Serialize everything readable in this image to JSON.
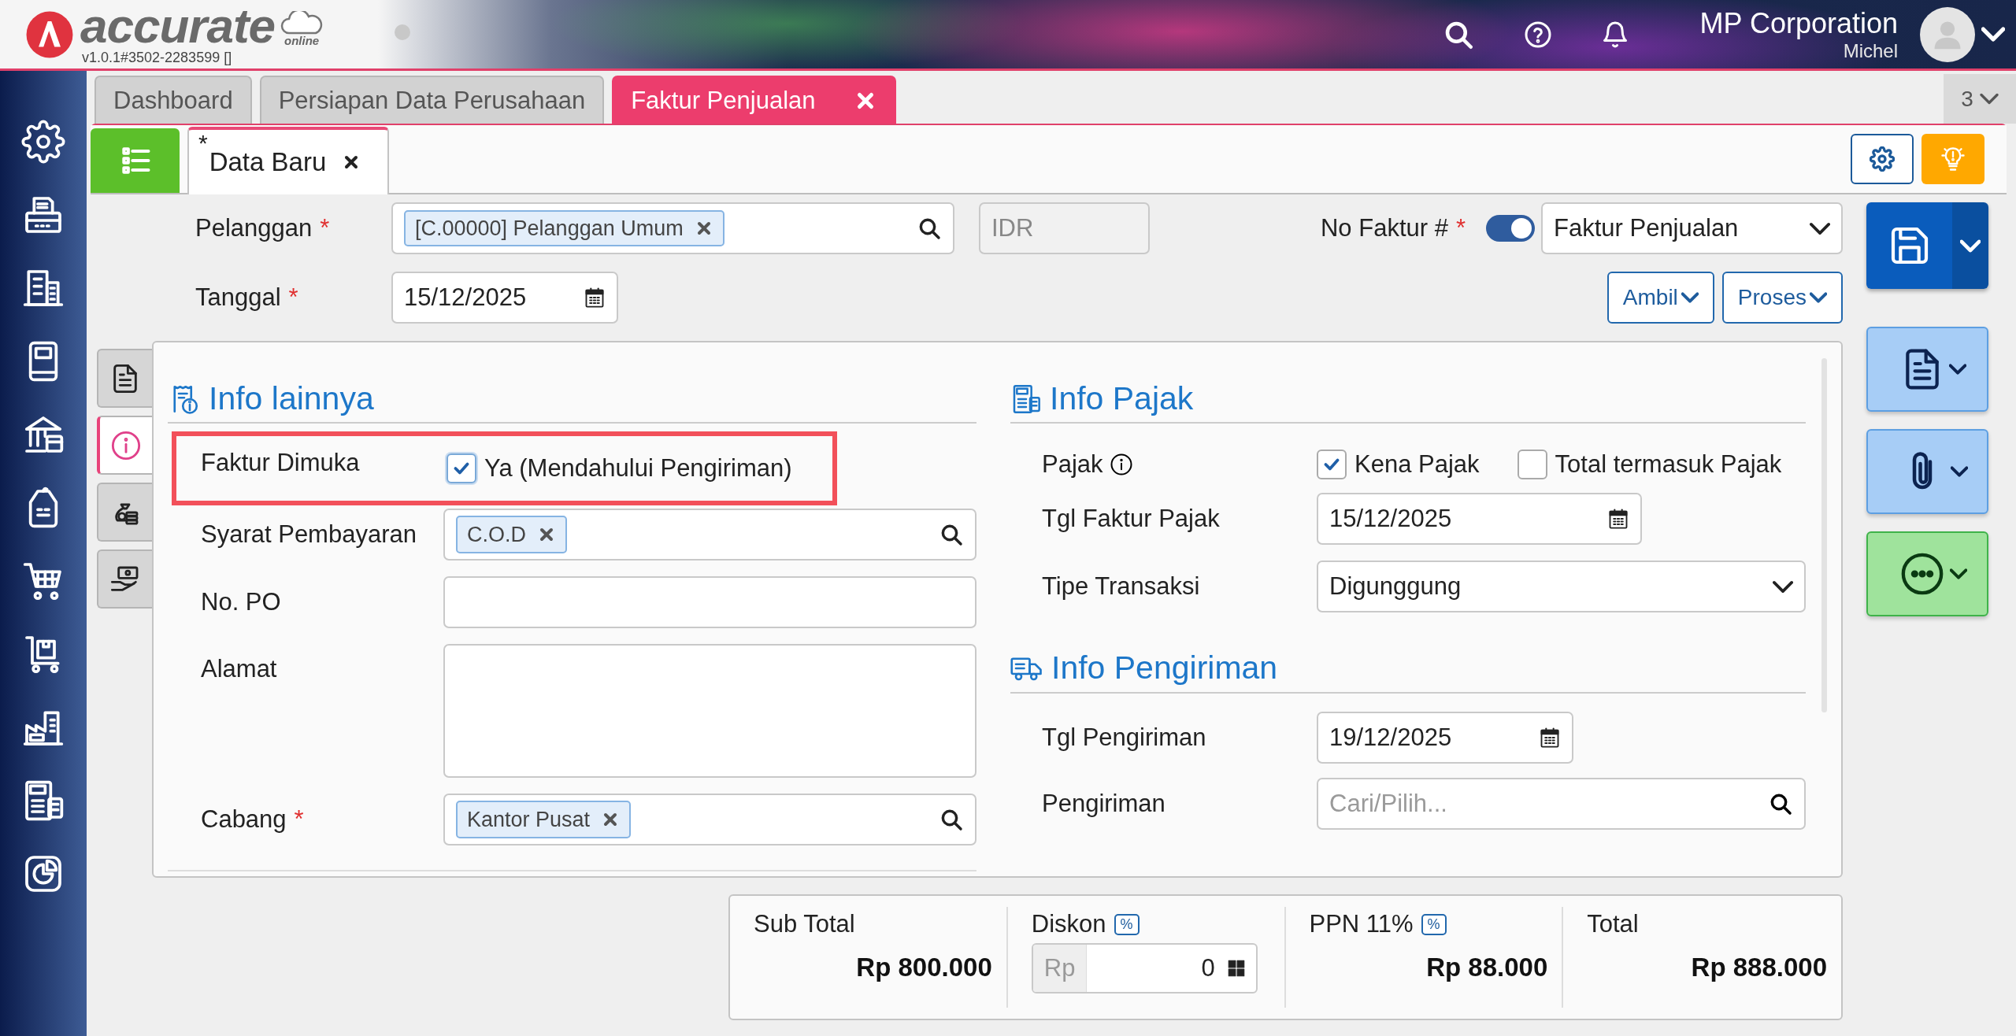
{
  "header": {
    "logo": "accurate",
    "logo_sub": "online",
    "version": "v1.0.1#3502-2283599 []",
    "company": "MP Corporation",
    "user": "Michel"
  },
  "tabs": [
    {
      "label": "Dashboard",
      "selected": false,
      "closable": false
    },
    {
      "label": "Persiapan Data Perusahaan",
      "selected": false,
      "closable": false
    },
    {
      "label": "Faktur Penjualan",
      "selected": true,
      "closable": true
    }
  ],
  "tab_count": "3",
  "subtab": {
    "label": "Data Baru",
    "modified_mark": "*",
    "selected": true,
    "closable": true
  },
  "form": {
    "customer": {
      "label": "Pelanggan",
      "mark": "*",
      "tag": "[C.00000] Pelanggan Umum"
    },
    "currency": {
      "value": "IDR",
      "disabled": true
    },
    "invoice_no": {
      "label": "No Faktur #",
      "mark": "*",
      "auto": true,
      "value": "Faktur Penjualan"
    },
    "date": {
      "label": "Tanggal",
      "mark": "*",
      "value": "15/12/2025"
    },
    "buttons": [
      "Ambil",
      "Proses"
    ]
  },
  "side_tabs": [
    {
      "kind": "document",
      "selected": false
    },
    {
      "kind": "info",
      "selected": true
    },
    {
      "kind": "money",
      "selected": false
    },
    {
      "kind": "payment",
      "selected": false
    }
  ],
  "info_lainnya": {
    "title": "Info lainnya",
    "advance_invoice": {
      "label": "Faktur Dimuka",
      "checked": true,
      "option": "Ya (Mendahului Pengiriman)",
      "highlighted": true
    },
    "payment_terms": {
      "label": "Syarat Pembayaran",
      "tag": "C.O.D"
    },
    "po": {
      "label": "No. PO"
    },
    "address": {
      "label": "Alamat"
    },
    "branch": {
      "label": "Cabang",
      "mark": "*",
      "tag": "Kantor Pusat"
    }
  },
  "info_pajak": {
    "title": "Info Pajak",
    "tax": {
      "label": "Pajak",
      "options": [
        {
          "label": "Kena Pajak",
          "checked": true
        },
        {
          "label": "Total termasuk Pajak",
          "checked": false
        }
      ]
    },
    "tax_date": {
      "label": "Tgl Faktur Pajak",
      "value": "15/12/2025"
    },
    "transaction_type": {
      "label": "Tipe Transaksi",
      "value": "Digunggung"
    }
  },
  "info_pengiriman": {
    "title": "Info Pengiriman",
    "ship_date": {
      "label": "Tgl Pengiriman",
      "value": "19/12/2025"
    },
    "shipper": {
      "label": "Pengiriman",
      "placeholder": "Cari/Pilih..."
    }
  },
  "totals": {
    "subtotal": {
      "label": "Sub Total",
      "value": "Rp 800.000"
    },
    "discount": {
      "label": "Diskon",
      "unit": "%",
      "prefix": "Rp",
      "value": "0"
    },
    "tax": {
      "label": "PPN 11%",
      "unit": "%",
      "value": "Rp 88.000"
    },
    "total": {
      "label": "Total",
      "value": "Rp 888.000"
    }
  }
}
